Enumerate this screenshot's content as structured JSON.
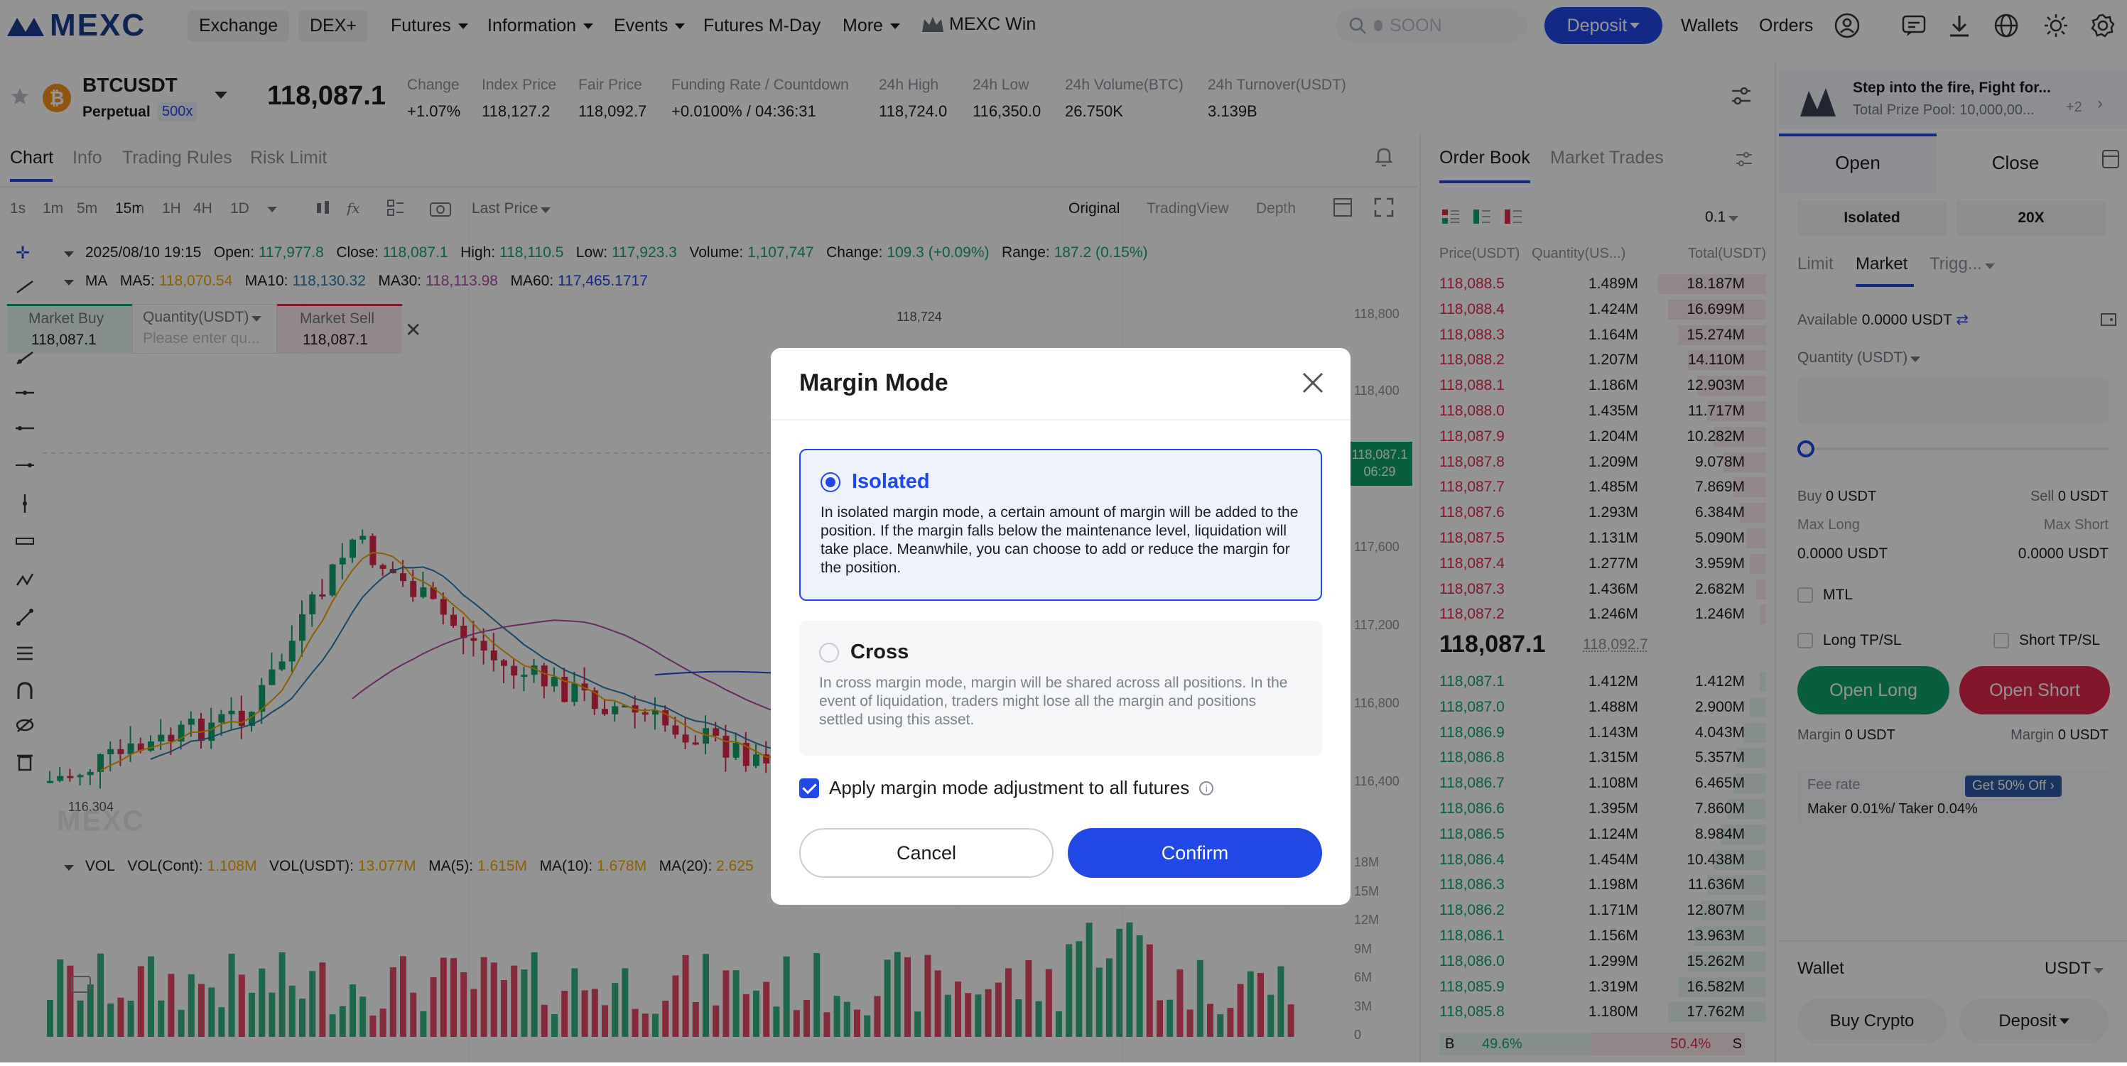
{
  "nav": {
    "logo_text": "MEXC",
    "items": [
      "Exchange",
      "DEX+",
      "Futures",
      "Information",
      "Events",
      "Futures M-Day",
      "More",
      "MEXC Win"
    ],
    "search_placeholder": "SOON",
    "deposit": "Deposit",
    "wallets": "Wallets",
    "orders": "Orders"
  },
  "ticker": {
    "symbol": "BTCUSDT",
    "type": "Perpetual",
    "leverage": "500x",
    "last_price": "118,087.1",
    "change_label": "Change",
    "change_value": "+1.07%",
    "index_label": "Index Price",
    "index_value": "118,127.2",
    "fair_label": "Fair Price",
    "fair_value": "118,092.7",
    "funding_label": "Funding Rate",
    "countdown_label": "Countdown",
    "funding_value": "+0.0100%",
    "countdown_value": "04:36:31",
    "high_label": "24h High",
    "high_value": "118,724.0",
    "low_label": "24h Low",
    "low_value": "116,350.0",
    "vol_label": "24h Volume(BTC)",
    "vol_value": "26.750K",
    "turnover_label": "24h Turnover(USDT)",
    "turnover_value": "3.139B"
  },
  "chart_tabs": [
    "Chart",
    "Info",
    "Trading Rules",
    "Risk Limit"
  ],
  "intervals": [
    "1s",
    "1m",
    "5m",
    "15m",
    "1H",
    "4H",
    "1D"
  ],
  "price_type": "Last Price",
  "views": [
    "Original",
    "TradingView",
    "Depth"
  ],
  "chart_info": {
    "date": "2025/08/10 19:15",
    "open_label": "Open:",
    "open": "117,977.8",
    "close_label": "Close:",
    "close": "118,087.1",
    "high_label": "High:",
    "high": "118,110.5",
    "low_label": "Low:",
    "low": "117,923.3",
    "volume_label": "Volume:",
    "volume": "1,107,747",
    "change_label": "Change:",
    "change": "109.3 (+0.09%)",
    "range_label": "Range:",
    "range": "187.2 (0.15%)"
  },
  "ma_row": {
    "ma": "MA",
    "ma5_label": "MA5:",
    "ma5": "118,070.54",
    "ma10_label": "MA10:",
    "ma10": "118,130.32",
    "ma30_label": "MA30:",
    "ma30": "118,113.98",
    "ma60_label": "MA60:",
    "ma60": "117,465.1717"
  },
  "quick_trade": {
    "buy_label": "Market Buy",
    "buy_price": "118,087.1",
    "qty_label": "Quantity(USDT)",
    "qty_placeholder": "Please enter qu...",
    "sell_label": "Market Sell",
    "sell_price": "118,087.1"
  },
  "chart_axis": [
    "118,800",
    "118,400",
    "117,600",
    "117,200",
    "116,800",
    "116,400"
  ],
  "chart_marks": {
    "high": "118,724",
    "low": "116,304",
    "last_tag": "118,087.1",
    "last_tag_time": "06:29"
  },
  "vol_row": {
    "label": "VOL",
    "cont_label": "VOL(Cont):",
    "cont": "1.108M",
    "usdt_label": "VOL(USDT):",
    "usdt": "13.077M",
    "ma5_label": "MA(5):",
    "ma5": "1.615M",
    "ma10_label": "MA(10):",
    "ma10": "1.678M",
    "ma20_label": "MA(20):",
    "ma20": "2.625"
  },
  "vol_axis": [
    "18M",
    "15M",
    "12M",
    "9M",
    "6M",
    "3M",
    "0"
  ],
  "orderbook": {
    "tabs": [
      "Order Book",
      "Market Trades"
    ],
    "precision": "0.1",
    "headers": [
      "Price(USDT)",
      "Quantity(US...)",
      "Total(USDT)"
    ],
    "asks": [
      [
        "118,088.5",
        "1.489M",
        "18.187M"
      ],
      [
        "118,088.4",
        "1.424M",
        "16.699M"
      ],
      [
        "118,088.3",
        "1.164M",
        "15.274M"
      ],
      [
        "118,088.2",
        "1.207M",
        "14.110M"
      ],
      [
        "118,088.1",
        "1.186M",
        "12.903M"
      ],
      [
        "118,088.0",
        "1.435M",
        "11.717M"
      ],
      [
        "118,087.9",
        "1.204M",
        "10.282M"
      ],
      [
        "118,087.8",
        "1.209M",
        "9.078M"
      ],
      [
        "118,087.7",
        "1.485M",
        "7.869M"
      ],
      [
        "118,087.6",
        "1.293M",
        "6.384M"
      ],
      [
        "118,087.5",
        "1.131M",
        "5.090M"
      ],
      [
        "118,087.4",
        "1.277M",
        "3.959M"
      ],
      [
        "118,087.3",
        "1.436M",
        "2.682M"
      ],
      [
        "118,087.2",
        "1.246M",
        "1.246M"
      ]
    ],
    "mid_price": "118,087.1",
    "mid_fair": "118,092.7",
    "bids": [
      [
        "118,087.1",
        "1.412M",
        "1.412M"
      ],
      [
        "118,087.0",
        "1.488M",
        "2.900M"
      ],
      [
        "118,086.9",
        "1.143M",
        "4.043M"
      ],
      [
        "118,086.8",
        "1.315M",
        "5.357M"
      ],
      [
        "118,086.7",
        "1.108M",
        "6.465M"
      ],
      [
        "118,086.6",
        "1.395M",
        "7.860M"
      ],
      [
        "118,086.5",
        "1.124M",
        "8.984M"
      ],
      [
        "118,086.4",
        "1.454M",
        "10.438M"
      ],
      [
        "118,086.3",
        "1.198M",
        "11.636M"
      ],
      [
        "118,086.2",
        "1.171M",
        "12.807M"
      ],
      [
        "118,086.1",
        "1.156M",
        "13.963M"
      ],
      [
        "118,086.0",
        "1.299M",
        "15.262M"
      ],
      [
        "118,085.9",
        "1.319M",
        "16.582M"
      ],
      [
        "118,085.8",
        "1.180M",
        "17.762M"
      ]
    ],
    "ask_depth": [
      0.33,
      0.3,
      0.27,
      0.24,
      0.21,
      0.18,
      0.16,
      0.13,
      0.1,
      0.08,
      0.06,
      0.05,
      0.03,
      0.02
    ],
    "bid_depth": [
      0.02,
      0.05,
      0.07,
      0.09,
      0.1,
      0.12,
      0.14,
      0.16,
      0.18,
      0.2,
      0.22,
      0.24,
      0.27,
      0.3
    ],
    "buy_label": "B",
    "buy_pct": "49.6%",
    "sell_pct": "50.4%",
    "sell_label": "S"
  },
  "promo": {
    "title": "Step into the fire, Fight for...",
    "sub": "Total Prize Pool: 10,000,00...",
    "plus": "+2"
  },
  "trade": {
    "tabs": [
      "Open",
      "Close"
    ],
    "mode": "Isolated",
    "leverage": "20X",
    "order_types": [
      "Limit",
      "Market",
      "Trigg..."
    ],
    "available_label": "Available",
    "available_value": "0.0000 USDT",
    "qty_label": "Quantity (USDT)",
    "buy_label": "Buy",
    "buy_value": "0 USDT",
    "sell_label": "Sell",
    "sell_value": "0 USDT",
    "maxlong_label": "Max Long",
    "maxlong_value": "0.0000 USDT",
    "maxshort_label": "Max Short",
    "maxshort_value": "0.0000 USDT",
    "mtl": "MTL",
    "long_tpsl": "Long TP/SL",
    "short_tpsl": "Short TP/SL",
    "open_long": "Open Long",
    "open_short": "Open Short",
    "margin_label": "Margin",
    "margin_long": "0 USDT",
    "margin_short": "0 USDT",
    "fee_label": "Fee rate",
    "fee_promo": "Get 50% Off",
    "fee_value": "Maker 0.01%/ Taker 0.04%",
    "wallet_label": "Wallet",
    "wallet_currency": "USDT",
    "buy_crypto": "Buy Crypto",
    "deposit": "Deposit"
  },
  "modal": {
    "title": "Margin Mode",
    "isolated_title": "Isolated",
    "isolated_desc": "In isolated margin mode, a certain amount of margin will be added to the position. If the margin falls below the maintenance level, liquidation will take place. Meanwhile, you can choose to add or reduce the margin for the position.",
    "cross_title": "Cross",
    "cross_desc": "In cross margin mode, margin will be shared across all positions. In the event of liquidation, traders might lose all the margin and positions settled using this asset.",
    "apply_all": "Apply margin mode adjustment to all futures",
    "cancel": "Cancel",
    "confirm": "Confirm",
    "selected": "Isolated",
    "apply_checked": true
  },
  "colors": {
    "brand": "#1f48e6",
    "up": "#11a36b",
    "down": "#e0294a",
    "ma5": "#f0a500",
    "ma10": "#2a7ab0",
    "ma30": "#b04aa8",
    "ma60": "#1f48e6"
  }
}
